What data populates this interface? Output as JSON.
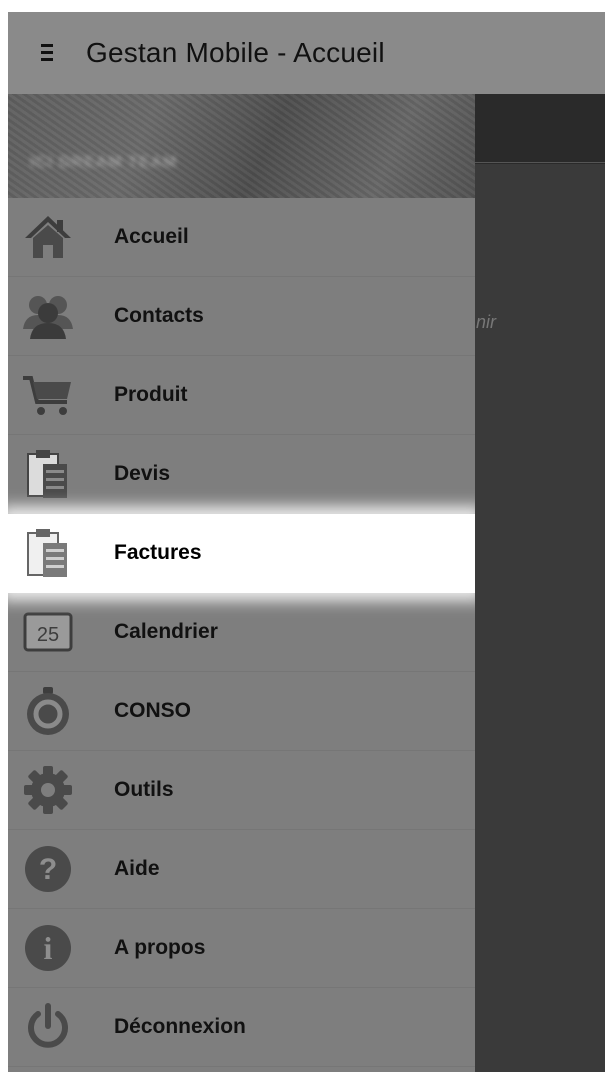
{
  "app_bar": {
    "title": "Gestan Mobile - Accueil",
    "menu_icon": "hamburger-menu-icon"
  },
  "drawer": {
    "header_text": "ICI DREAM TEAM",
    "items": [
      {
        "label": "Accueil",
        "icon": "home-icon"
      },
      {
        "label": "Contacts",
        "icon": "contacts-icon"
      },
      {
        "label": "Produit",
        "icon": "cart-icon"
      },
      {
        "label": "Devis",
        "icon": "clipboard-icon"
      },
      {
        "label": "Factures",
        "icon": "clipboard-icon",
        "selected": true
      },
      {
        "label": "Calendrier",
        "icon": "calendar-icon",
        "icon_text": "25"
      },
      {
        "label": "CONSO",
        "icon": "timer-icon"
      },
      {
        "label": "Outils",
        "icon": "gear-icon"
      },
      {
        "label": "Aide",
        "icon": "help-icon",
        "icon_text": "?"
      },
      {
        "label": "A propos",
        "icon": "info-icon",
        "icon_text": "i"
      },
      {
        "label": "Déconnexion",
        "icon": "power-icon"
      }
    ]
  },
  "background_content": {
    "snippet": "nir"
  },
  "colors": {
    "app_bar": "#8a8a8a",
    "drawer": "#7e7e7e",
    "content": "#3a3a3a",
    "selected_item": "#ffffff"
  }
}
